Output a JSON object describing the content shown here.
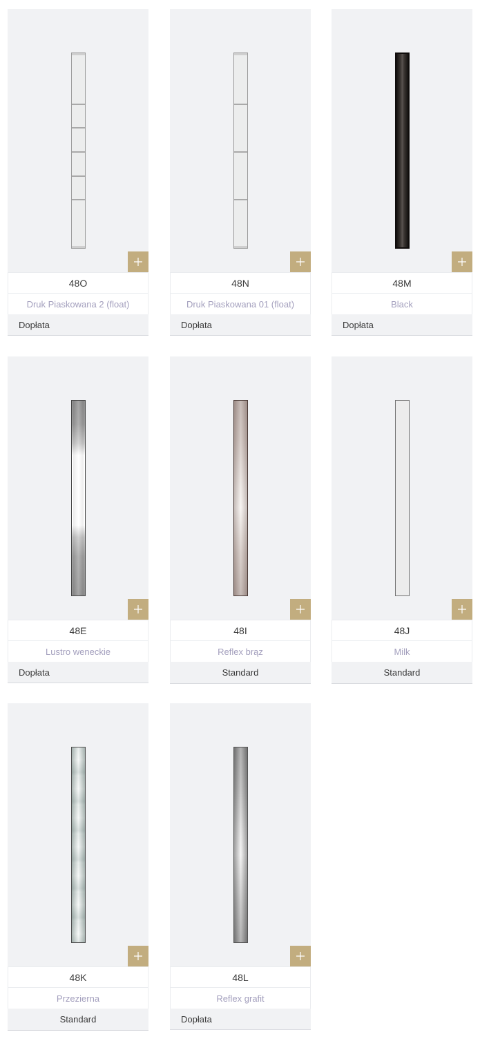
{
  "accent_color": "#c2ad7f",
  "add_icon": "plus-icon",
  "products": [
    {
      "code": "48O",
      "name": "Druk Piaskowana 2 (float)",
      "price": "Dopłata"
    },
    {
      "code": "48N",
      "name": "Druk Piaskowana 01 (float)",
      "price": "Dopłata"
    },
    {
      "code": "48M",
      "name": "Black",
      "price": "Dopłata"
    },
    {
      "code": "48E",
      "name": "Lustro weneckie",
      "price": "Dopłata"
    },
    {
      "code": "48I",
      "name": "Reflex brąz",
      "price": "Standard"
    },
    {
      "code": "48J",
      "name": "Milk",
      "price": "Standard"
    },
    {
      "code": "48K",
      "name": "Przezierna",
      "price": "Standard"
    },
    {
      "code": "48L",
      "name": "Reflex grafit",
      "price": "Dopłata"
    }
  ]
}
